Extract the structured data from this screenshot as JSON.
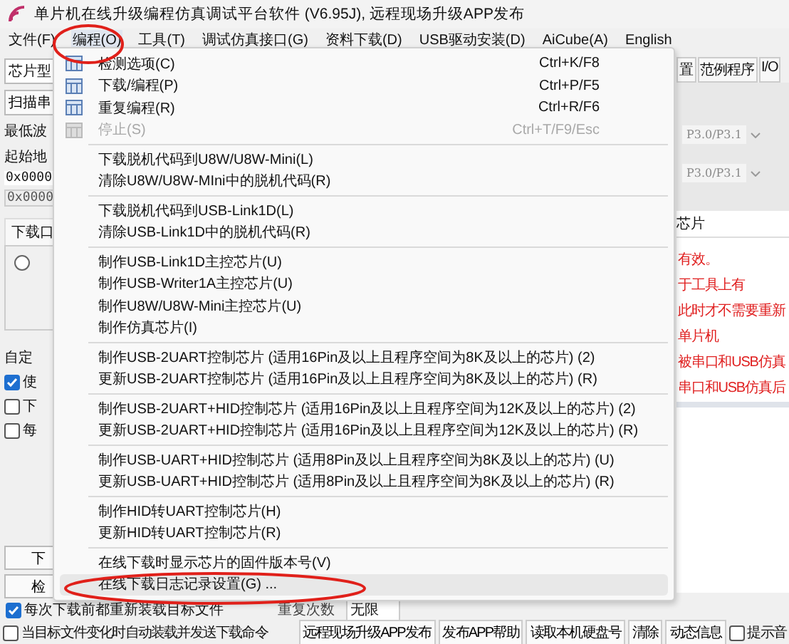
{
  "window": {
    "title": "单片机在线升级编程仿真调试平台软件 (V6.95J), 远程现场升级APP发布"
  },
  "menubar": [
    {
      "label": "文件(F)",
      "selected": false
    },
    {
      "label": "编程(O)",
      "selected": true
    },
    {
      "label": "工具(T)",
      "selected": false
    },
    {
      "label": "调试仿真接口(G)",
      "selected": false
    },
    {
      "label": "资料下载(D)",
      "selected": false
    },
    {
      "label": "USB驱动安装(D)",
      "selected": false
    },
    {
      "label": "AiCube(A)",
      "selected": false
    },
    {
      "label": "English",
      "selected": false
    }
  ],
  "menu": {
    "items": [
      {
        "kind": "item",
        "label": "检测选项(C)",
        "shortcut": "Ctrl+K/F8",
        "icon": true,
        "disabled": false,
        "selected": false
      },
      {
        "kind": "item",
        "label": "下载/编程(P)",
        "shortcut": "Ctrl+P/F5",
        "icon": true,
        "disabled": false,
        "selected": false
      },
      {
        "kind": "item",
        "label": "重复编程(R)",
        "shortcut": "Ctrl+R/F6",
        "icon": true,
        "disabled": false,
        "selected": false
      },
      {
        "kind": "item",
        "label": "停止(S)",
        "shortcut": "Ctrl+T/F9/Esc",
        "icon": true,
        "disabled": true,
        "selected": false
      },
      {
        "kind": "separator"
      },
      {
        "kind": "item",
        "label": "下载脱机代码到U8W/U8W-Mini(L)",
        "disabled": false,
        "selected": false
      },
      {
        "kind": "item",
        "label": "清除U8W/U8W-MIni中的脱机代码(R)",
        "disabled": false,
        "selected": false
      },
      {
        "kind": "separator"
      },
      {
        "kind": "item",
        "label": "下载脱机代码到USB-Link1D(L)",
        "disabled": false,
        "selected": false
      },
      {
        "kind": "item",
        "label": "清除USB-Link1D中的脱机代码(R)",
        "disabled": false,
        "selected": false
      },
      {
        "kind": "separator"
      },
      {
        "kind": "item",
        "label": "制作USB-Link1D主控芯片(U)",
        "disabled": false,
        "selected": false
      },
      {
        "kind": "item",
        "label": "制作USB-Writer1A主控芯片(U)",
        "disabled": false,
        "selected": false
      },
      {
        "kind": "item",
        "label": "制作U8W/U8W-Mini主控芯片(U)",
        "disabled": false,
        "selected": false
      },
      {
        "kind": "item",
        "label": "制作仿真芯片(I)",
        "disabled": false,
        "selected": false
      },
      {
        "kind": "separator"
      },
      {
        "kind": "item",
        "label": "制作USB-2UART控制芯片 (适用16Pin及以上且程序空间为8K及以上的芯片) (2)",
        "disabled": false,
        "selected": false
      },
      {
        "kind": "item",
        "label": "更新USB-2UART控制芯片 (适用16Pin及以上且程序空间为8K及以上的芯片) (R)",
        "disabled": false,
        "selected": false
      },
      {
        "kind": "separator"
      },
      {
        "kind": "item",
        "label": "制作USB-2UART+HID控制芯片 (适用16Pin及以上且程序空间为12K及以上的芯片) (2)",
        "disabled": false,
        "selected": false
      },
      {
        "kind": "item",
        "label": "更新USB-2UART+HID控制芯片 (适用16Pin及以上且程序空间为12K及以上的芯片) (R)",
        "disabled": false,
        "selected": false
      },
      {
        "kind": "separator"
      },
      {
        "kind": "item",
        "label": "制作USB-UART+HID控制芯片 (适用8Pin及以上且程序空间为8K及以上的芯片) (U)",
        "disabled": false,
        "selected": false
      },
      {
        "kind": "item",
        "label": "更新USB-UART+HID控制芯片 (适用8Pin及以上且程序空间为8K及以上的芯片) (R)",
        "disabled": false,
        "selected": false
      },
      {
        "kind": "separator"
      },
      {
        "kind": "item",
        "label": "制作HID转UART控制芯片(H)",
        "disabled": false,
        "selected": false
      },
      {
        "kind": "item",
        "label": "更新HID转UART控制芯片(R)",
        "disabled": false,
        "selected": false
      },
      {
        "kind": "separator"
      },
      {
        "kind": "item",
        "label": "在线下载时显示芯片的固件版本号(V)",
        "disabled": false,
        "selected": false
      },
      {
        "kind": "item",
        "label": "在线下载日志记录设置(G) ...",
        "disabled": false,
        "selected": true
      }
    ]
  },
  "left_panel": {
    "chip_combo": "芯片型",
    "scan_button": "扫描串",
    "baud_label": "最低波",
    "start_label": "起始地",
    "address_1": "0x0000",
    "address_2": "0x0000",
    "tab": "下载口",
    "radio": {
      "selected": false
    },
    "custom_label": "自定",
    "checkboxes": [
      {
        "label": "使",
        "checked": true
      },
      {
        "label": "下",
        "checked": false
      },
      {
        "label": "每",
        "checked": false
      }
    ],
    "buttons": [
      "下",
      "检"
    ]
  },
  "right_panel": {
    "tabs": [
      "置",
      "范例程序",
      "I/O"
    ],
    "combos": [
      "P3.0/P3.1",
      "P3.0/P3.1"
    ],
    "chip_label": "芯片",
    "notes": [
      "有效。",
      "于工具上有",
      "此时才不需要重新",
      "单片机",
      "被串口和USB仿真",
      "串口和USB仿真后"
    ]
  },
  "bottom": {
    "reload_checkbox": {
      "label": "每次下载前都重新装载目标文件",
      "checked": true
    },
    "repeat_label": "重复次数",
    "repeat_value": "无限",
    "auto_checkbox": {
      "label": "当目标文件变化时自动装载并发送下载命令",
      "checked": false
    },
    "buttons": [
      "远程现场升级APP发布",
      "发布APP帮助",
      "读取本机硬盘号",
      "清除",
      "动态信息"
    ],
    "sound_checkbox": {
      "label": "提示音",
      "checked": false
    }
  }
}
